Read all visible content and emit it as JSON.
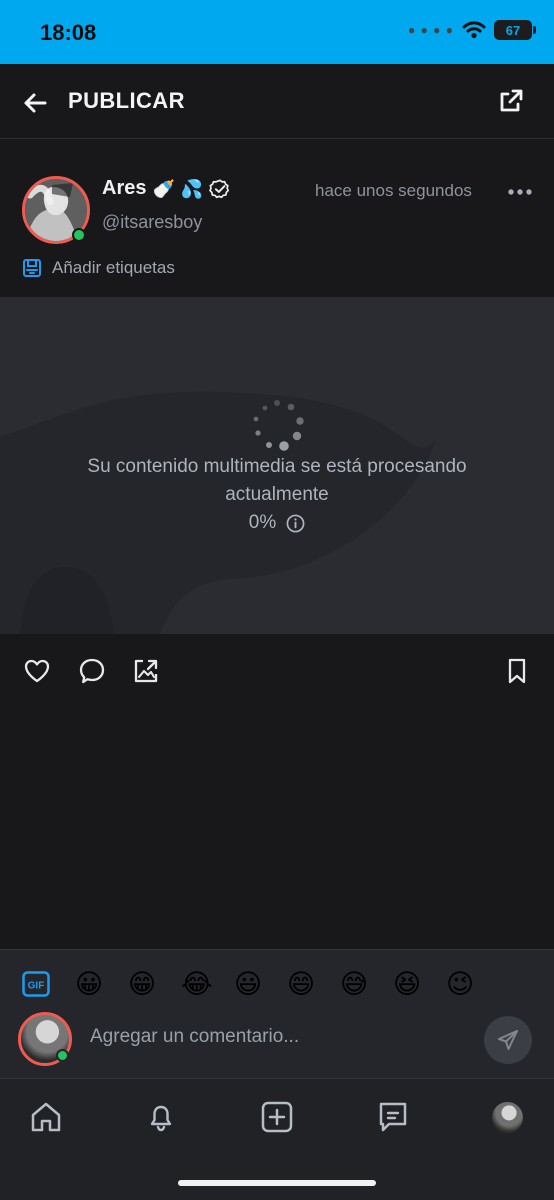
{
  "status": {
    "time": "18:08",
    "battery": "67"
  },
  "header": {
    "title": "PUBLICAR"
  },
  "post": {
    "name": "Ares",
    "name_emojis": [
      "🍼",
      "💦"
    ],
    "handle": "@itsaresboy",
    "time": "hace unos segundos",
    "tags_label": "Añadir etiquetas",
    "processing_text": "Su contenido multimedia se está procesando actualmente",
    "progress": "0%"
  },
  "comment_bar": {
    "placeholder": "Agregar un comentario...",
    "emojis": [
      "😀",
      "😁",
      "😂",
      "😃",
      "😄",
      "😅",
      "😆",
      "😉"
    ]
  },
  "icons": {
    "back": "arrow-left-icon",
    "share": "share-icon",
    "verified": "verified-badge-icon",
    "more": "more-horizontal-icon",
    "tags": "tag-icon",
    "like": "heart-icon",
    "comment": "comment-icon",
    "repost": "image-repost-icon",
    "bookmark": "bookmark-icon",
    "gif": "gif-icon",
    "send": "send-icon",
    "home": "home-icon",
    "notifications": "bell-icon",
    "create": "plus-square-icon",
    "messages": "message-icon"
  },
  "colors": {
    "status_bar": "#00a9ef",
    "background": "#18181b",
    "media_background": "#2a2c31",
    "accent_blue": "#1d9bf0",
    "online": "#22c55e",
    "avatar_ring": "#f15b4f"
  }
}
